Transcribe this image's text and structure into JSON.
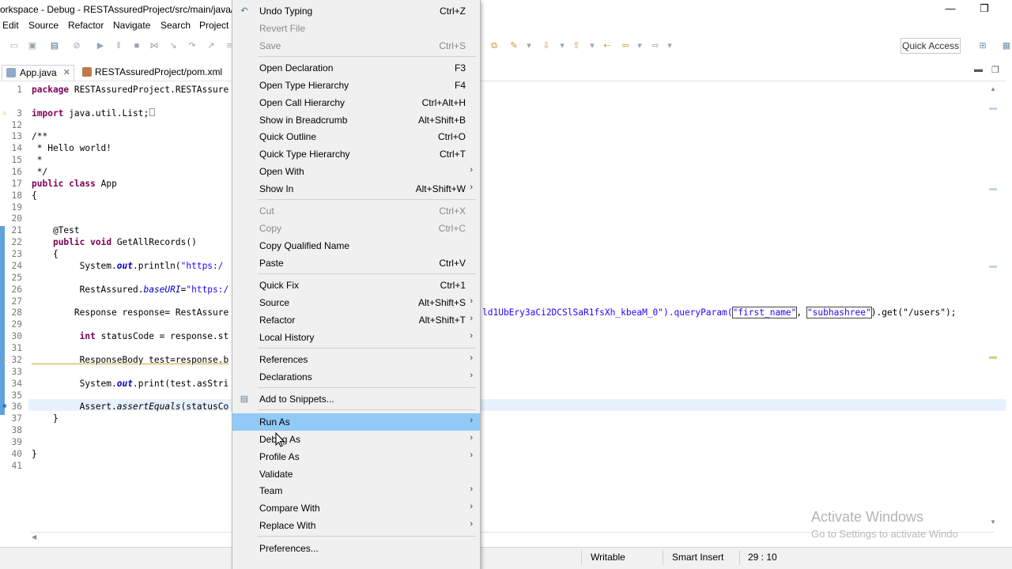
{
  "window": {
    "title": "orkspace - Debug - RESTAssuredProject/src/main/java/RE",
    "minimize": "—",
    "restore": "❐"
  },
  "menubar": [
    "Edit",
    "Source",
    "Refactor",
    "Navigate",
    "Search",
    "Project"
  ],
  "toolbar": {
    "quick_access": "Quick Access"
  },
  "tabs": [
    {
      "label": "App.java",
      "close": "✕"
    },
    {
      "label": "RESTAssuredProject/pom.xml"
    }
  ],
  "editor": {
    "lines": [
      {
        "n": "1",
        "code": "package RESTAssuredProject.RESTAssure"
      },
      {
        "n": "3",
        "code": "import java.util.List;"
      },
      {
        "n": "12",
        "code": ""
      },
      {
        "n": "13",
        "code": "/**"
      },
      {
        "n": "14",
        "code": " * Hello world!"
      },
      {
        "n": "15",
        "code": " *"
      },
      {
        "n": "16",
        "code": " */"
      },
      {
        "n": "17",
        "code": "public class App"
      },
      {
        "n": "18",
        "code": "{"
      },
      {
        "n": "19",
        "code": ""
      },
      {
        "n": "20",
        "code": ""
      },
      {
        "n": "21",
        "code": "    @Test"
      },
      {
        "n": "22",
        "code": "    public void GetAllRecords()"
      },
      {
        "n": "23",
        "code": "    {"
      },
      {
        "n": "24",
        "code": "         System.out.println(\"https:/"
      },
      {
        "n": "25",
        "code": ""
      },
      {
        "n": "26",
        "code": "         RestAssured.baseURI=\"https:/"
      },
      {
        "n": "27",
        "code": ""
      },
      {
        "n": "28",
        "code": "        Response response= RestAssure"
      },
      {
        "n": "29",
        "code": ""
      },
      {
        "n": "30",
        "code": "         int statusCode = response.st"
      },
      {
        "n": "31",
        "code": ""
      },
      {
        "n": "32",
        "code": "         ResponseBody test=response.b"
      },
      {
        "n": "33",
        "code": ""
      },
      {
        "n": "34",
        "code": "         System.out.print(test.asStri"
      },
      {
        "n": "35",
        "code": ""
      },
      {
        "n": "36",
        "code": "         Assert.assertEquals(statusCo"
      },
      {
        "n": "37",
        "code": "    }"
      },
      {
        "n": "38",
        "code": ""
      },
      {
        "n": "39",
        "code": ""
      },
      {
        "n": "40",
        "code": "}"
      },
      {
        "n": "41",
        "code": ""
      }
    ],
    "line28_right_pre": "ld1UbEry3aCi2DCSlSaR1fsXh_kbeaM_0\").queryParam(",
    "line28_param1": "\"first_name\"",
    "line28_comma": ", ",
    "line28_param2": "\"subhashree\"",
    "line28_right_post": ").get(\"/users\");"
  },
  "context_menu": {
    "items": [
      {
        "label": "Undo Typing",
        "shortcut": "Ctrl+Z",
        "icon": "undo-icon"
      },
      {
        "label": "Revert File",
        "shortcut": "",
        "disabled": true
      },
      {
        "label": "Save",
        "shortcut": "Ctrl+S",
        "disabled": true
      },
      {
        "label": "Open Declaration",
        "shortcut": "F3"
      },
      {
        "label": "Open Type Hierarchy",
        "shortcut": "F4"
      },
      {
        "label": "Open Call Hierarchy",
        "shortcut": "Ctrl+Alt+H"
      },
      {
        "label": "Show in Breadcrumb",
        "shortcut": "Alt+Shift+B"
      },
      {
        "label": "Quick Outline",
        "shortcut": "Ctrl+O"
      },
      {
        "label": "Quick Type Hierarchy",
        "shortcut": "Ctrl+T"
      },
      {
        "label": "Open With",
        "submenu": true
      },
      {
        "label": "Show In",
        "shortcut": "Alt+Shift+W",
        "submenu": true
      },
      {
        "label": "Cut",
        "shortcut": "Ctrl+X",
        "disabled": true
      },
      {
        "label": "Copy",
        "shortcut": "Ctrl+C",
        "disabled": true
      },
      {
        "label": "Copy Qualified Name",
        "shortcut": ""
      },
      {
        "label": "Paste",
        "shortcut": "Ctrl+V"
      },
      {
        "label": "Quick Fix",
        "shortcut": "Ctrl+1"
      },
      {
        "label": "Source",
        "shortcut": "Alt+Shift+S",
        "submenu": true
      },
      {
        "label": "Refactor",
        "shortcut": "Alt+Shift+T",
        "submenu": true
      },
      {
        "label": "Local History",
        "submenu": true
      },
      {
        "label": "References",
        "submenu": true
      },
      {
        "label": "Declarations",
        "submenu": true
      },
      {
        "label": "Add to Snippets...",
        "icon": "snippets-icon"
      },
      {
        "label": "Run As",
        "submenu": true,
        "highlighted": true
      },
      {
        "label": "Debug As",
        "submenu": true
      },
      {
        "label": "Profile As",
        "submenu": true
      },
      {
        "label": "Validate"
      },
      {
        "label": "Team",
        "submenu": true
      },
      {
        "label": "Compare With",
        "submenu": true
      },
      {
        "label": "Replace With",
        "submenu": true
      },
      {
        "label": "Preferences..."
      }
    ],
    "highlight_color": "#91c9f7"
  },
  "statusbar": {
    "mode": "Writable",
    "insert": "Smart Insert",
    "position": "29 : 10"
  },
  "watermark": {
    "title": "Activate Windows",
    "subtitle": "Go to Settings to activate Windo"
  }
}
